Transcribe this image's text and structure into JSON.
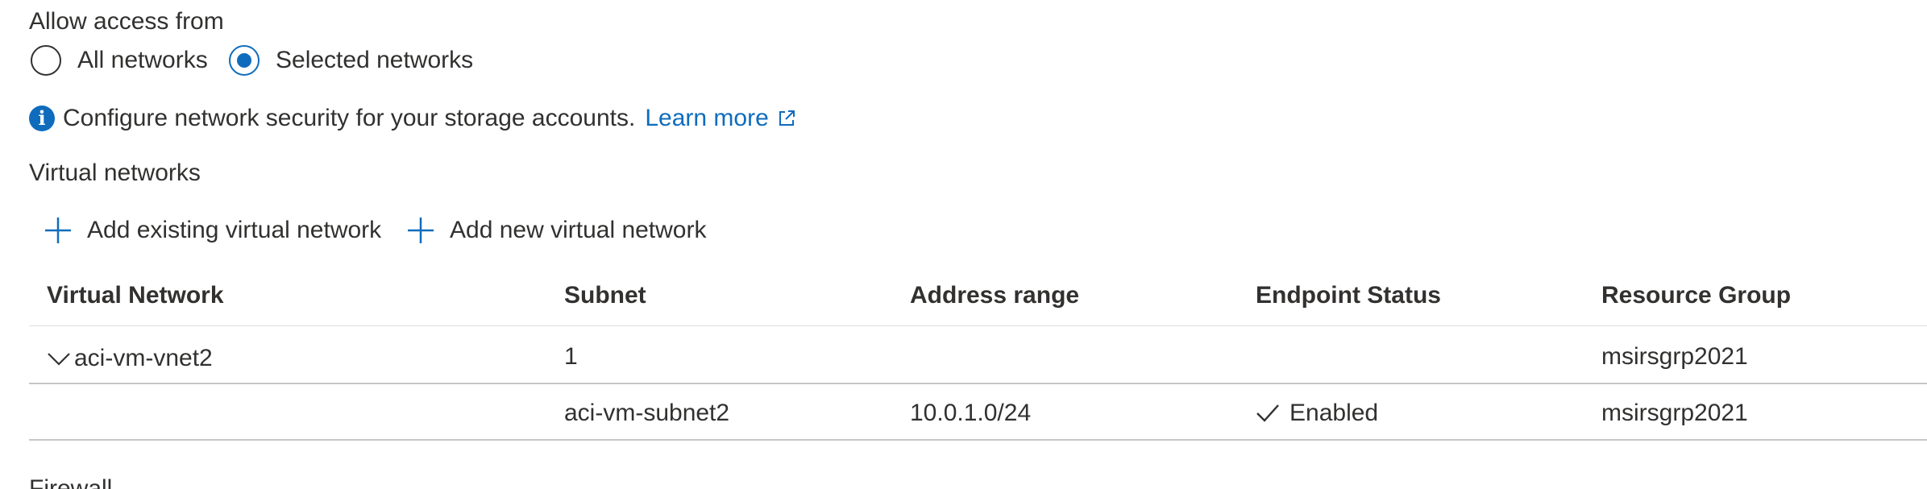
{
  "access": {
    "label": "Allow access from",
    "options": [
      {
        "label": "All networks",
        "selected": false
      },
      {
        "label": "Selected networks",
        "selected": true
      }
    ]
  },
  "info": {
    "text": "Configure network security for your storage accounts.",
    "link": "Learn more"
  },
  "virtual_networks": {
    "title": "Virtual networks",
    "toolbar": {
      "add_existing": "Add existing virtual network",
      "add_new": "Add new virtual network"
    },
    "columns": [
      "Virtual Network",
      "Subnet",
      "Address range",
      "Endpoint Status",
      "Resource Group"
    ],
    "group_row": {
      "vnet": "aci-vm-vnet2",
      "subnet": "1",
      "address_range": "",
      "endpoint_status": "",
      "resource_group": "msirsgrp2021"
    },
    "child_rows": [
      {
        "vnet": "",
        "subnet": "aci-vm-subnet2",
        "address_range": "10.0.1.0/24",
        "endpoint_status": "Enabled",
        "resource_group": "msirsgrp2021"
      }
    ]
  },
  "next_section": {
    "title": "Firewall"
  },
  "colors": {
    "accent": "#0f6cbd",
    "text": "#323130",
    "divider": "#e1dfdd"
  }
}
